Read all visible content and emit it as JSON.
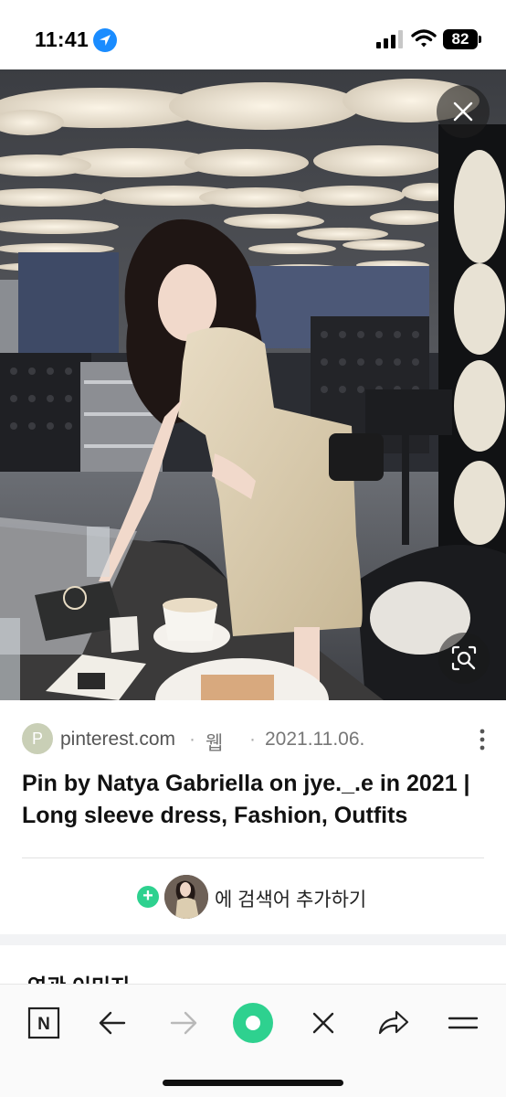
{
  "status_bar": {
    "time": "11:41",
    "battery": "82"
  },
  "source": {
    "avatar_letter": "P",
    "domain": "pinterest.com",
    "sep": "·",
    "type": "웹",
    "date": "2021.11.06."
  },
  "title": "Pin by Natya Gabriella on jye._.e in 2021 | Long sleeve dress, Fashion, Outfits",
  "add_to_search": {
    "plus": "+",
    "label": "에 검색어 추가하기"
  },
  "related": {
    "heading": "연관 이미지"
  },
  "toolbar": {
    "n_label": "N"
  },
  "icons": [
    "location-icon",
    "signal-icon",
    "wifi-icon",
    "close-icon",
    "lens-search-icon",
    "more-vertical-icon",
    "plus-icon",
    "back-arrow-icon",
    "forward-arrow-icon",
    "green-dot-icon",
    "close-x-icon",
    "share-icon",
    "menu-icon"
  ],
  "colors": {
    "accent_green": "#2ed18f",
    "location_blue": "#1a8cff"
  }
}
